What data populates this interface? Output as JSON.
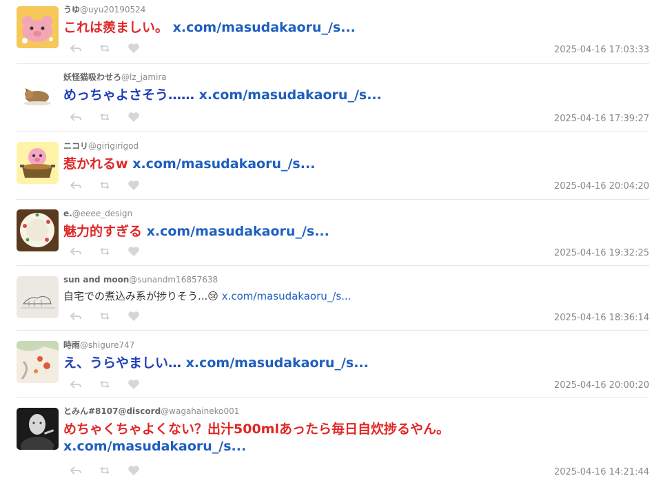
{
  "tweets": [
    {
      "display_name": "うゆ",
      "handle": "@uyu20190524",
      "text": "これは羨ましい。",
      "text_color": "#e02727",
      "link": "x.com/masudakaoru_/s...",
      "timestamp": "2025-04-16 17:03:33",
      "avatar": "pink-pig-avatar"
    },
    {
      "display_name": "妖怪猫吸わせろ",
      "handle": "@lz_jamira",
      "text": "めっちゃよさそう……",
      "text_color": "#1f3fb8",
      "link": "x.com/masudakaoru_/s...",
      "timestamp": "2025-04-16 17:39:27",
      "avatar": "sleeping-cat-avatar"
    },
    {
      "display_name": "ニコリ",
      "handle": "@girigirigod",
      "text": "惹かれるw",
      "text_color": "#e02727",
      "link": "x.com/masudakaoru_/s...",
      "timestamp": "2025-04-16 20:04:20",
      "avatar": "pig-pot-avatar"
    },
    {
      "display_name": "e.",
      "handle": "@eeee_design",
      "text": "魅力的すぎる",
      "text_color": "#e02727",
      "link": "x.com/masudakaoru_/s...",
      "timestamp": "2025-04-16 19:32:25",
      "avatar": "plate-avatar"
    },
    {
      "display_name": "sun and moon",
      "handle": "@sunandm16857638",
      "text": "自宅での煮込み系が捗りそう...😢",
      "text_color": "#333333",
      "link": "x.com/masudakaoru_/s...",
      "timestamp": "2025-04-16 18:36:14",
      "avatar": "sketch-avatar"
    },
    {
      "display_name": "時雨",
      "handle": "@shigure747",
      "text": "え、うらやましい…",
      "text_color": "#1f3fb8",
      "link": "x.com/masudakaoru_/s...",
      "timestamp": "2025-04-16 20:00:20",
      "avatar": "painting-avatar"
    },
    {
      "display_name": "とみん#8107@discord",
      "handle": "@wagahaineko001",
      "text": "めちゃくちゃよくない？出汁500mlあったら毎日自炊捗るやん。",
      "text_color": "#e02727",
      "link": "x.com/masudakaoru_/s...",
      "timestamp": "2025-04-16 14:21:44",
      "avatar": "portrait-avatar"
    }
  ],
  "action_icons": [
    "reply-icon",
    "retweet-icon",
    "like-icon"
  ],
  "colors": {
    "red_text": "#e02727",
    "blue_text": "#1f3fb8",
    "link": "#1f5fbf",
    "timestamp": "#888888",
    "divider": "#e6e6e6"
  }
}
